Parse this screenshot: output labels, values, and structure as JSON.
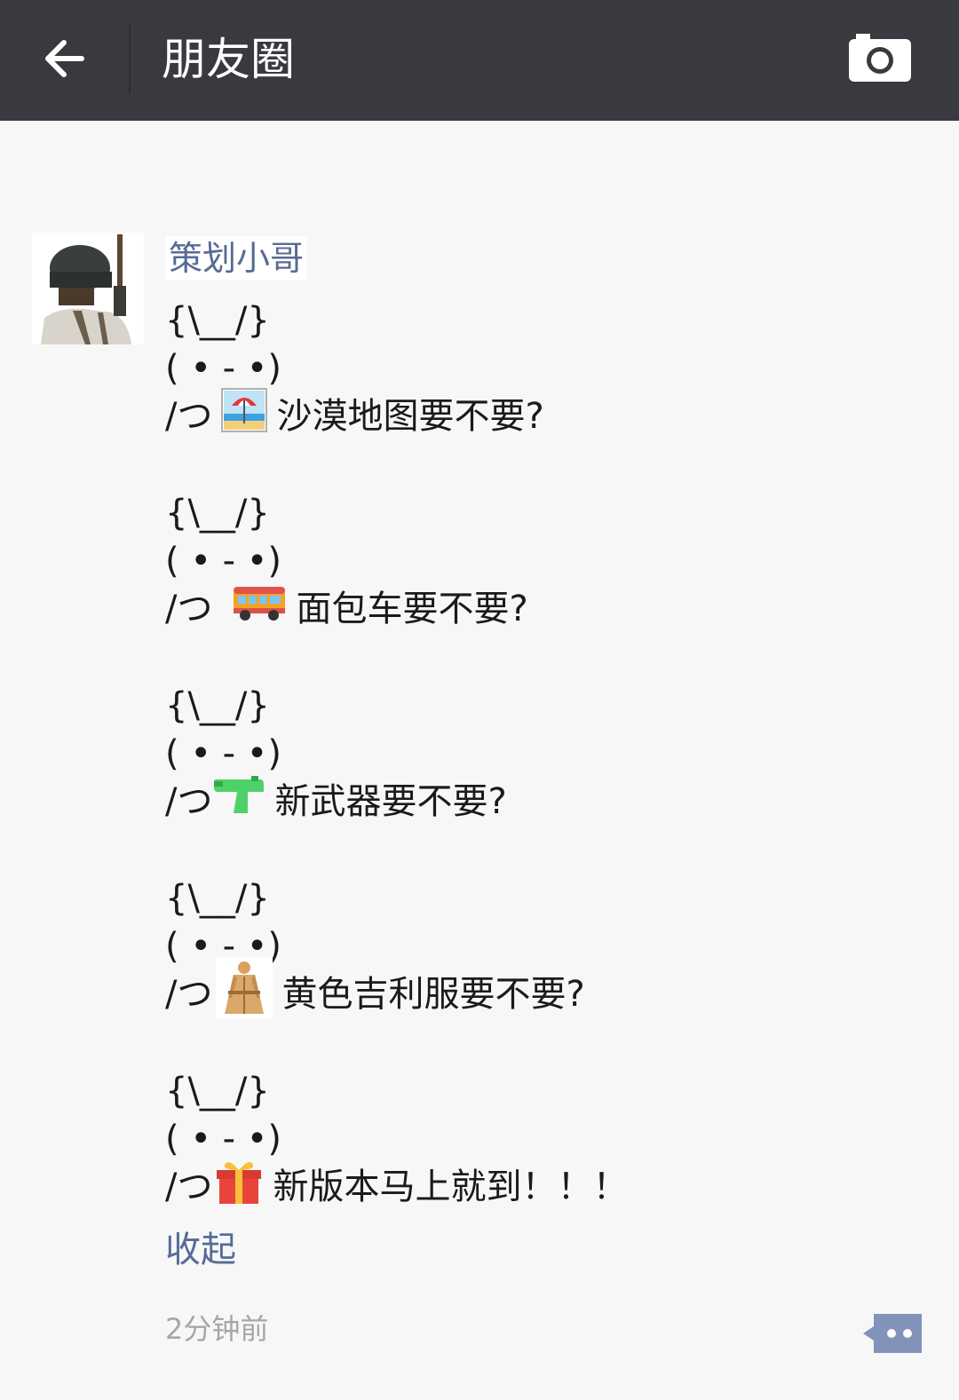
{
  "header": {
    "title": "朋友圈",
    "back_icon": "back-arrow-icon",
    "camera_icon": "camera-icon"
  },
  "post": {
    "author": "策划小哥",
    "avatar_icon": "player-avatar",
    "blocks": [
      {
        "ears": "{\\__/}",
        "face": "( • - •)",
        "hands": "/つ",
        "emoji": "beach-umbrella-icon",
        "text": "沙漠地图要不要?"
      },
      {
        "ears": "{\\__/}",
        "face": "( • - •)",
        "hands": "/つ",
        "emoji": "bus-icon",
        "text": "面包车要不要?"
      },
      {
        "ears": "{\\__/}",
        "face": "( • - •)",
        "hands": "/つ",
        "emoji": "water-pistol-icon",
        "text": "新武器要不要?"
      },
      {
        "ears": "{\\__/}",
        "face": "( • - •)",
        "hands": "/つ",
        "emoji": "raincoat-icon",
        "text": "黄色吉利服要不要?"
      },
      {
        "ears": "{\\__/}",
        "face": "( • - •)",
        "hands": "/つ",
        "emoji": "gift-icon",
        "text": "新版本马上就到！！！"
      }
    ],
    "collapse_label": "收起",
    "time": "2分钟前",
    "comment_icon": "comment-icon"
  },
  "colors": {
    "topbar": "#393a3f",
    "link": "#576b95",
    "background": "#f7f7f7",
    "timestamp": "#a6a6a6"
  }
}
